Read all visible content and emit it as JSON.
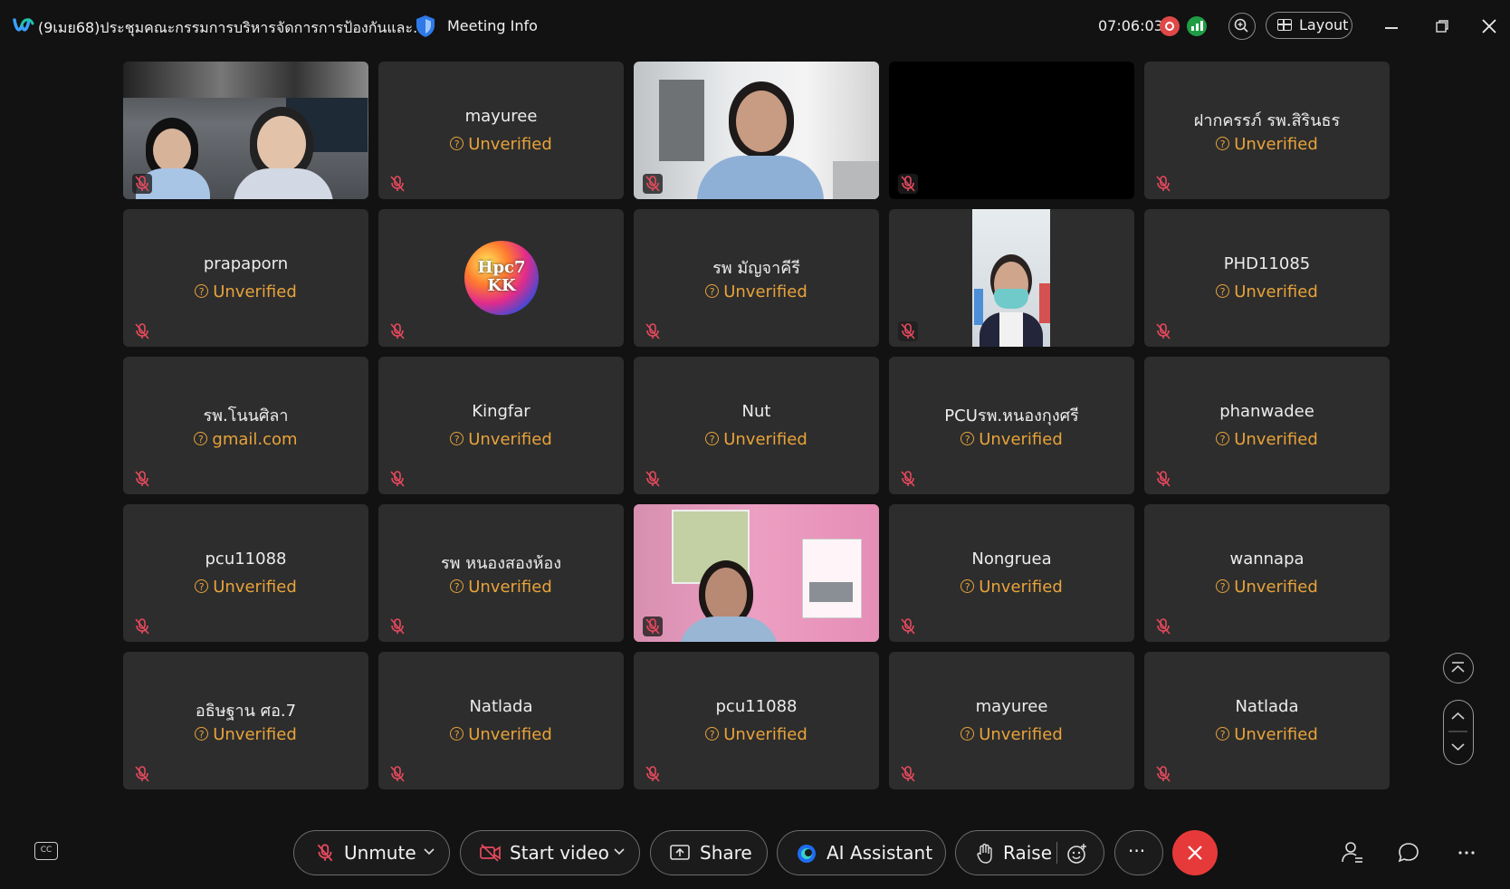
{
  "topbar": {
    "meeting_title": "(9เมย68)ประชุมคณะกรรมการบริหารจัดการการป้องกันและ...",
    "meeting_info_label": "Meeting Info",
    "timer": "07:06:03",
    "layout_label": "Layout"
  },
  "tiles": [
    {
      "name": "",
      "sub": "",
      "kind": "video"
    },
    {
      "name": "mayuree",
      "sub": "Unverified",
      "kind": "name"
    },
    {
      "name": "",
      "sub": "",
      "kind": "video"
    },
    {
      "name": "",
      "sub": "",
      "kind": "black"
    },
    {
      "name": "ฝากครรภ์ รพ.สิรินธร",
      "sub": "Unverified",
      "kind": "name"
    },
    {
      "name": "prapaporn",
      "sub": "Unverified",
      "kind": "name"
    },
    {
      "name": "Hpc7 KK",
      "sub": "",
      "kind": "avatar"
    },
    {
      "name": "รพ มัญจาคีรี",
      "sub": "Unverified",
      "kind": "name"
    },
    {
      "name": "",
      "sub": "",
      "kind": "video"
    },
    {
      "name": "PHD11085",
      "sub": "Unverified",
      "kind": "name"
    },
    {
      "name": "รพ.โนนศิลา",
      "sub": "gmail.com",
      "kind": "name"
    },
    {
      "name": "Kingfar",
      "sub": "Unverified",
      "kind": "name"
    },
    {
      "name": "Nut",
      "sub": "Unverified",
      "kind": "name"
    },
    {
      "name": "PCUรพ.หนองกุงศรี",
      "sub": "Unverified",
      "kind": "name"
    },
    {
      "name": "phanwadee",
      "sub": "Unverified",
      "kind": "name"
    },
    {
      "name": "pcu11088",
      "sub": "Unverified",
      "kind": "name"
    },
    {
      "name": "รพ หนองสองห้อง",
      "sub": "Unverified",
      "kind": "name"
    },
    {
      "name": "",
      "sub": "",
      "kind": "video"
    },
    {
      "name": "Nongruea",
      "sub": "Unverified",
      "kind": "name"
    },
    {
      "name": "wannapa",
      "sub": "Unverified",
      "kind": "name"
    },
    {
      "name": "อธิษฐาน ศอ.7",
      "sub": "Unverified",
      "kind": "name"
    },
    {
      "name": "Natlada",
      "sub": "Unverified",
      "kind": "name"
    },
    {
      "name": "pcu11088",
      "sub": "Unverified",
      "kind": "name"
    },
    {
      "name": "mayuree",
      "sub": "Unverified",
      "kind": "name"
    },
    {
      "name": "Natlada",
      "sub": "Unverified",
      "kind": "name"
    }
  ],
  "controls": {
    "unmute_label": "Unmute",
    "start_video_label": "Start video",
    "share_label": "Share",
    "ai_assistant_label": "AI Assistant",
    "raise_label": "Raise",
    "more_label": "···"
  },
  "colors": {
    "accent_unverified": "#e8a33a",
    "mute_red": "#e5495d",
    "leave_red": "#e63a3a",
    "tile_bg": "#2d2d2d"
  }
}
